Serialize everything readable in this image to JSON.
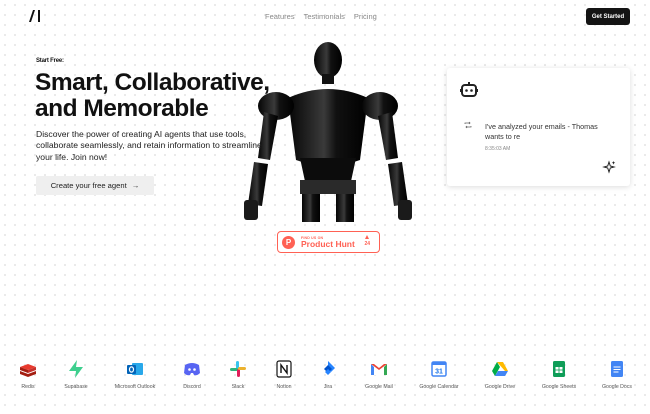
{
  "header": {
    "nav": [
      "Features",
      "Testimonials",
      "Pricing"
    ],
    "cta": "Get Started"
  },
  "hero": {
    "eyebrow": "Start Free:",
    "headline_line1": "Smart, Collaborative,",
    "headline_line2": "and Memorable",
    "subtext": "Discover the power of creating AI agents that use tools, collaborate seamlessly, and retain information to streamline your life. Join now!",
    "button": "Create your free agent",
    "button_arrow": "→"
  },
  "product_hunt": {
    "small": "FIND US ON",
    "big": "Product Hunt",
    "letter": "P",
    "votes": "24",
    "color": "#ff6154"
  },
  "chat": {
    "message": "I've analyzed your emails - Thomas wants to re",
    "time": "8:35:03 AM"
  },
  "integrations": [
    {
      "name": "Redis",
      "icon": "redis-icon"
    },
    {
      "name": "Supabase",
      "icon": "supabase-icon"
    },
    {
      "name": "Microsoft Outlook",
      "icon": "outlook-icon"
    },
    {
      "name": "Discord",
      "icon": "discord-icon"
    },
    {
      "name": "Slack",
      "icon": "slack-icon"
    },
    {
      "name": "Notion",
      "icon": "notion-icon"
    },
    {
      "name": "Jira",
      "icon": "jira-icon"
    },
    {
      "name": "Google Mail",
      "icon": "gmail-icon"
    },
    {
      "name": "Google Calendar",
      "icon": "google-calendar-icon"
    },
    {
      "name": "Google Drive",
      "icon": "google-drive-icon"
    },
    {
      "name": "Google Sheets",
      "icon": "google-sheets-icon"
    },
    {
      "name": "Google Docs",
      "icon": "google-docs-icon"
    }
  ]
}
